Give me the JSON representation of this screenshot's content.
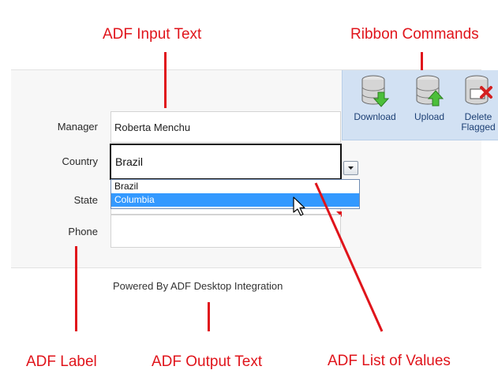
{
  "callouts": {
    "input_text": "ADF Input Text",
    "ribbon_commands": "Ribbon Commands",
    "label": "ADF Label",
    "output_text": "ADF Output Text",
    "list_of_values": "ADF List of Values"
  },
  "ribbon": {
    "download": "Download",
    "upload": "Upload",
    "delete_line1": "Delete",
    "delete_line2": "Flagged"
  },
  "form": {
    "manager_label": "Manager",
    "manager_value": "Roberta Menchu",
    "country_label": "Country",
    "country_value": "Brazil",
    "state_label": "State",
    "phone_label": "Phone",
    "phone_value": ""
  },
  "country_options": [
    "Brazil",
    "Columbia"
  ],
  "country_selected_index": 1,
  "footer": {
    "powered_by": "Powered By ADF Desktop Integration"
  },
  "colors": {
    "callout_red": "#e0141b",
    "ribbon_bg": "#d2e1f3",
    "selection_blue": "#3399ff"
  }
}
